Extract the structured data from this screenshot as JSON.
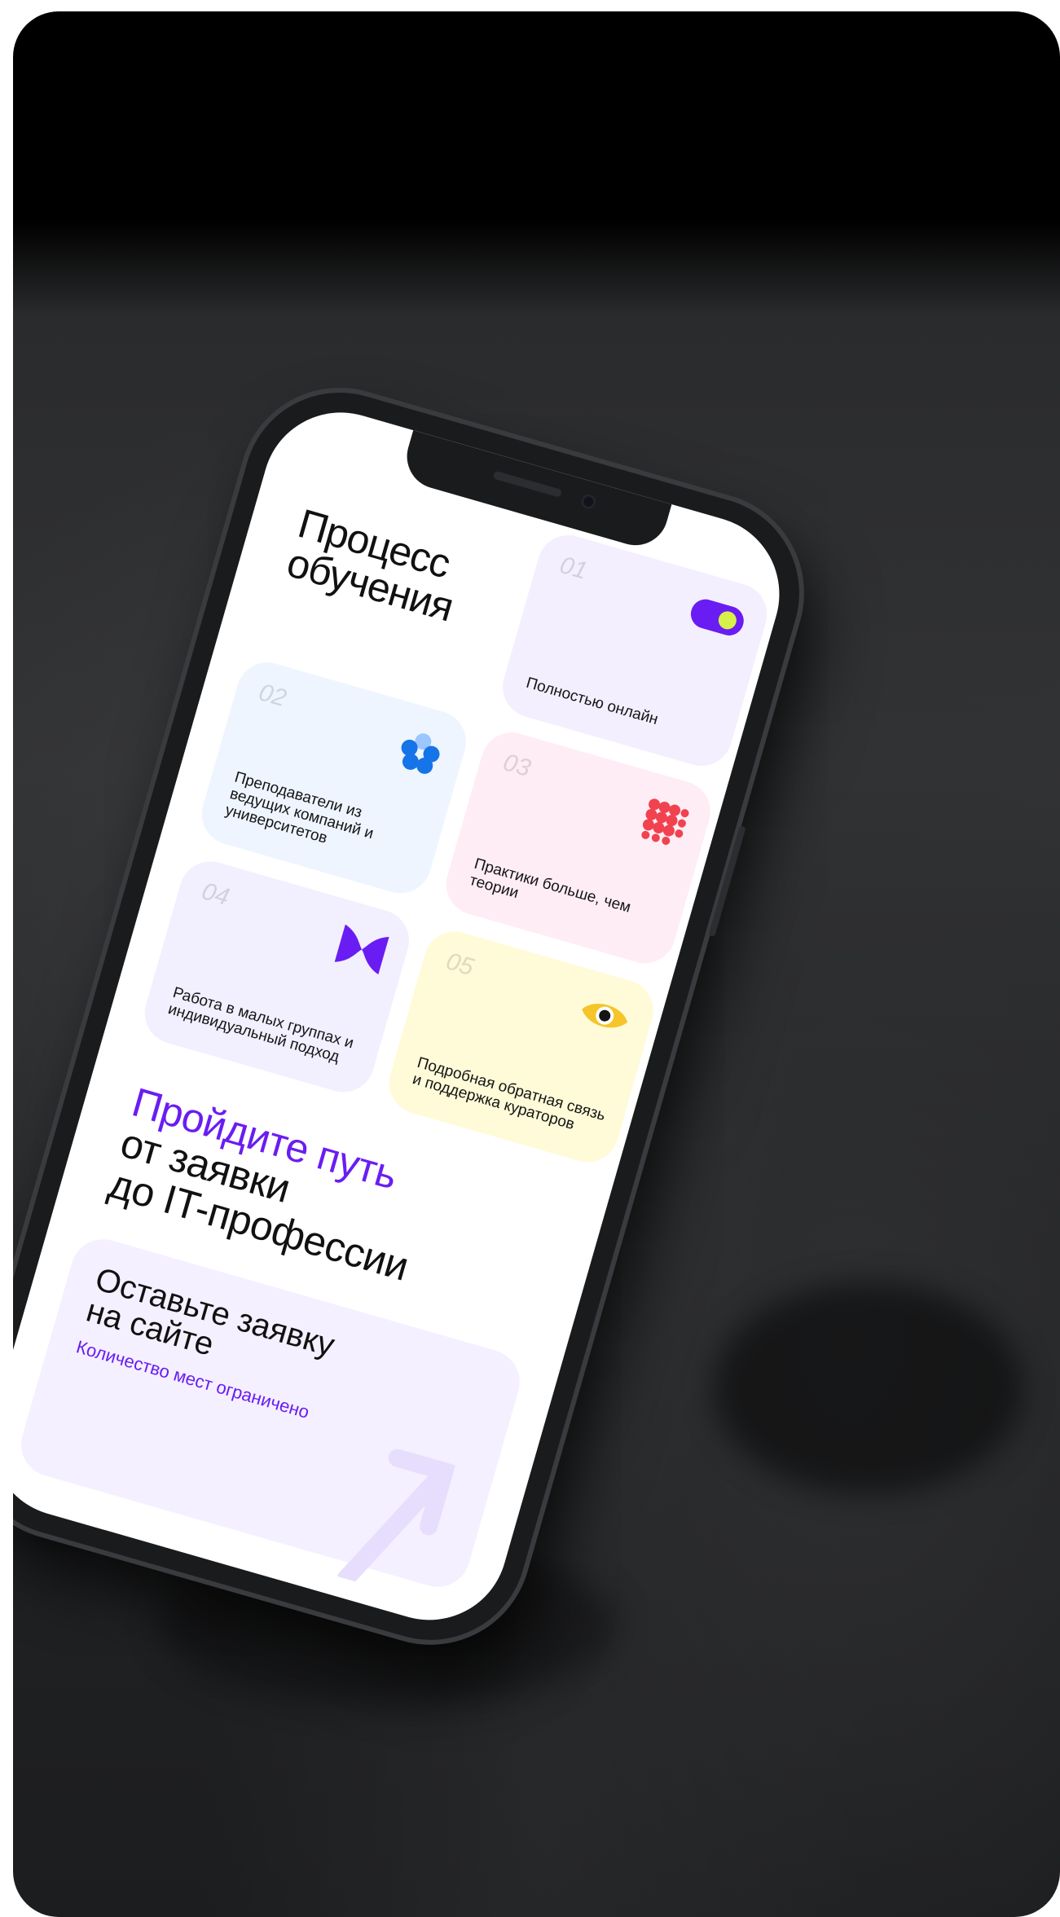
{
  "screen": {
    "title_line1": "Процесс",
    "title_line2": "обучения",
    "cards": [
      {
        "num": "01",
        "text": "Полностью онлайн",
        "icon": "toggle-icon",
        "icon_color": "#6a1df2",
        "accent": "#d8f04a"
      },
      {
        "num": "02",
        "text": "Преподаватели из ведущих компаний и университетов",
        "icon": "flower-icon",
        "icon_color": "#1574e8",
        "accent": "#9cc6ff"
      },
      {
        "num": "03",
        "text": "Практики больше, чем теории",
        "icon": "dots-grid-icon",
        "icon_color": "#f0434f"
      },
      {
        "num": "04",
        "text": "Работа в малых группах и индивидуальный подход",
        "icon": "bowtie-icon",
        "icon_color": "#6a1df2"
      },
      {
        "num": "05",
        "text": "Подробная обратная связь и поддержка кураторов",
        "icon": "eye-icon",
        "icon_color": "#f5c52a"
      }
    ],
    "path_title_accent": "Пройдите путь",
    "path_title_line2": "от заявки",
    "path_title_line3": "до IT-профессии",
    "cta": {
      "title_line1": "Оставьте заявку",
      "title_line2": "на сайте",
      "subtitle": "Количество мест ограничено"
    }
  }
}
